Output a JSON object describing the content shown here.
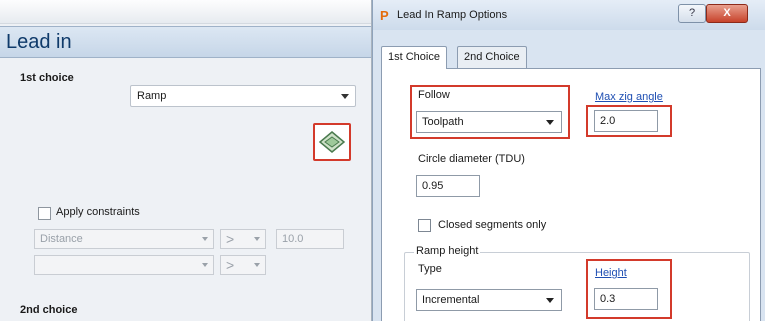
{
  "left_panel": {
    "header_title": "Lead in",
    "first_choice_label": "1st choice",
    "lead_type_value": "Ramp",
    "ramp_options_icon": "ramp-diamond-icon",
    "apply_constraints_label": "Apply constraints",
    "apply_constraints_checked": false,
    "constraint_row_1": {
      "type": "Distance",
      "operator": ">",
      "value": "10.0"
    },
    "constraint_row_2": {
      "type": "",
      "operator": ">"
    },
    "second_choice_label": "2nd choice"
  },
  "dialog": {
    "app_icon_letter": "P",
    "title": "Lead In Ramp Options",
    "help_label": "?",
    "close_label": "X",
    "tabs": [
      {
        "label": "1st Choice",
        "active": true
      },
      {
        "label": "2nd Choice",
        "active": false
      }
    ],
    "follow": {
      "label": "Follow",
      "value": "Toolpath"
    },
    "max_zig_angle": {
      "label": "Max zig angle",
      "value": "2.0"
    },
    "circle_diameter": {
      "label": "Circle diameter (TDU)",
      "value": "0.95"
    },
    "closed_segments": {
      "label": "Closed segments only",
      "checked": false
    },
    "ramp_height": {
      "group_label": "Ramp height",
      "type_label": "Type",
      "type_value": "Incremental",
      "height_label": "Height",
      "height_value": "0.3"
    }
  },
  "colors": {
    "highlight_red": "#d33a2b",
    "link_blue": "#1f4fb3",
    "header_text": "#0f3a6a"
  }
}
